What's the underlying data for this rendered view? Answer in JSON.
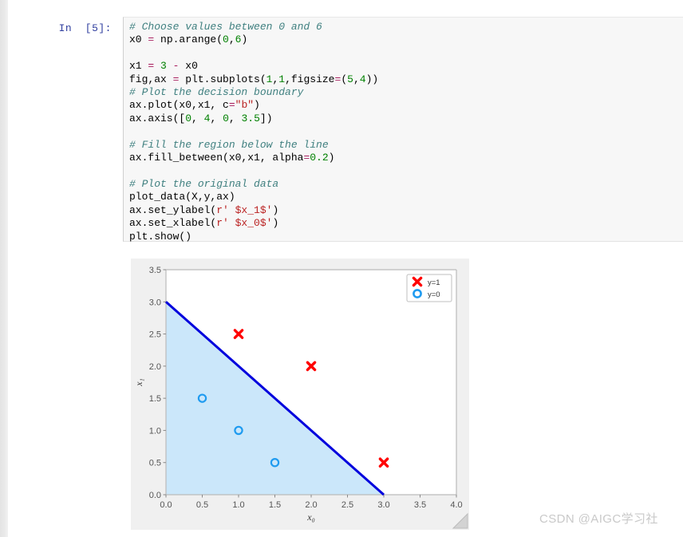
{
  "notebook": {
    "cell": {
      "prompt": "In  [5]:",
      "code_lines": [
        [
          {
            "t": "# Choose values between 0 and 6",
            "c": "com"
          }
        ],
        [
          {
            "t": "x0 ",
            "c": "plain"
          },
          {
            "t": "=",
            "c": "op"
          },
          {
            "t": " np.arange(",
            "c": "plain"
          },
          {
            "t": "0",
            "c": "num"
          },
          {
            "t": ",",
            "c": "plain"
          },
          {
            "t": "6",
            "c": "num"
          },
          {
            "t": ")",
            "c": "plain"
          }
        ],
        [
          {
            "t": "",
            "c": "plain"
          }
        ],
        [
          {
            "t": "x1 ",
            "c": "plain"
          },
          {
            "t": "=",
            "c": "op"
          },
          {
            "t": " ",
            "c": "plain"
          },
          {
            "t": "3",
            "c": "num"
          },
          {
            "t": " ",
            "c": "plain"
          },
          {
            "t": "-",
            "c": "op"
          },
          {
            "t": " x0",
            "c": "plain"
          }
        ],
        [
          {
            "t": "fig,ax ",
            "c": "plain"
          },
          {
            "t": "=",
            "c": "op"
          },
          {
            "t": " plt.subplots(",
            "c": "plain"
          },
          {
            "t": "1",
            "c": "num"
          },
          {
            "t": ",",
            "c": "plain"
          },
          {
            "t": "1",
            "c": "num"
          },
          {
            "t": ",figsize",
            "c": "plain"
          },
          {
            "t": "=",
            "c": "op"
          },
          {
            "t": "(",
            "c": "plain"
          },
          {
            "t": "5",
            "c": "num"
          },
          {
            "t": ",",
            "c": "plain"
          },
          {
            "t": "4",
            "c": "num"
          },
          {
            "t": "))",
            "c": "plain"
          }
        ],
        [
          {
            "t": "# Plot the decision boundary",
            "c": "com"
          }
        ],
        [
          {
            "t": "ax.plot(x0,x1, c",
            "c": "plain"
          },
          {
            "t": "=",
            "c": "op"
          },
          {
            "t": "\"b\"",
            "c": "str"
          },
          {
            "t": ")",
            "c": "plain"
          }
        ],
        [
          {
            "t": "ax.axis([",
            "c": "plain"
          },
          {
            "t": "0",
            "c": "num"
          },
          {
            "t": ", ",
            "c": "plain"
          },
          {
            "t": "4",
            "c": "num"
          },
          {
            "t": ", ",
            "c": "plain"
          },
          {
            "t": "0",
            "c": "num"
          },
          {
            "t": ", ",
            "c": "plain"
          },
          {
            "t": "3.5",
            "c": "num"
          },
          {
            "t": "])",
            "c": "plain"
          }
        ],
        [
          {
            "t": "",
            "c": "plain"
          }
        ],
        [
          {
            "t": "# Fill the region below the line",
            "c": "com"
          }
        ],
        [
          {
            "t": "ax.fill_between(x0,x1, alpha",
            "c": "plain"
          },
          {
            "t": "=",
            "c": "op"
          },
          {
            "t": "0.2",
            "c": "num"
          },
          {
            "t": ")",
            "c": "plain"
          }
        ],
        [
          {
            "t": "",
            "c": "plain"
          }
        ],
        [
          {
            "t": "# Plot the original data",
            "c": "com"
          }
        ],
        [
          {
            "t": "plot_data(X,y,ax)",
            "c": "plain"
          }
        ],
        [
          {
            "t": "ax.set_ylabel(",
            "c": "plain"
          },
          {
            "t": "r' $x_1$'",
            "c": "str"
          },
          {
            "t": ")",
            "c": "plain"
          }
        ],
        [
          {
            "t": "ax.set_xlabel(",
            "c": "plain"
          },
          {
            "t": "r' $x_0$'",
            "c": "str"
          },
          {
            "t": ")",
            "c": "plain"
          }
        ],
        [
          {
            "t": "plt.show()",
            "c": "plain"
          }
        ]
      ]
    }
  },
  "watermark": {
    "text": "CSDN @AIGC学习社"
  },
  "chart_data": {
    "type": "scatter",
    "title": "",
    "xlabel": "x₀",
    "ylabel": "x₁",
    "xlim": [
      0,
      4
    ],
    "ylim": [
      0,
      3.5
    ],
    "xticks": [
      "0.0",
      "0.5",
      "1.0",
      "1.5",
      "2.0",
      "2.5",
      "3.0",
      "3.5",
      "4.0"
    ],
    "xtick_values": [
      0.0,
      0.5,
      1.0,
      1.5,
      2.0,
      2.5,
      3.0,
      3.5,
      4.0
    ],
    "yticks": [
      "0.0",
      "0.5",
      "1.0",
      "1.5",
      "2.0",
      "2.5",
      "3.0",
      "3.5"
    ],
    "ytick_values": [
      0.0,
      0.5,
      1.0,
      1.5,
      2.0,
      2.5,
      3.0,
      3.5
    ],
    "grid": false,
    "legend_position": "upper right",
    "series": [
      {
        "name": "y=1",
        "marker": "x",
        "color": "#ff0000",
        "points": [
          [
            1.0,
            2.5
          ],
          [
            2.0,
            2.0
          ],
          [
            3.0,
            0.5
          ]
        ]
      },
      {
        "name": "y=0",
        "marker": "o",
        "color": "#1f9bf0",
        "points": [
          [
            0.5,
            1.5
          ],
          [
            1.0,
            1.0
          ],
          [
            1.5,
            0.5
          ]
        ]
      }
    ],
    "decision_boundary": {
      "name": "x1 = 3 - x0",
      "color": "#0000dd",
      "linewidth": 3,
      "points": [
        [
          0.0,
          3.0
        ],
        [
          3.0,
          0.0
        ]
      ]
    },
    "fill_region": {
      "name": "region below the line",
      "color": "#cbe7fa",
      "alpha": 0.2,
      "vertices": [
        [
          0.0,
          0.0
        ],
        [
          0.0,
          3.0
        ],
        [
          3.0,
          0.0
        ]
      ]
    },
    "figure_facecolor": "#f0f0f0",
    "axes_facecolor": "#ffffff"
  }
}
